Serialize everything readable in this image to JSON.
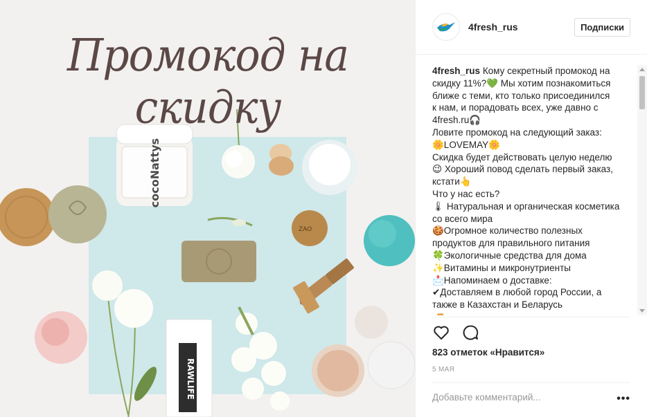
{
  "photo": {
    "title": "Промокод на скидку",
    "jar_brand": "cocoNattys",
    "bar_brand": "RAWLIFE",
    "compact_brand": "ZAO"
  },
  "post": {
    "username": "4fresh_rus",
    "follow_label": "Подписки",
    "caption_lines": [
      "Кому секретный промокод на",
      "скидку 11%?💚 Мы хотим познакомиться",
      "ближе с теми, кто только присоединился",
      "к нам, и порадовать всех, уже давно с",
      "4fresh.ru🎧",
      "Ловите промокод на следующий заказ:",
      "🌼LOVEMAY🌼",
      "Скидка будет действовать целую неделю",
      "😉 Хороший повод сделать первый заказ,",
      "кстати👆",
      "Что у нас есть?",
      "🌡 Натуральная и органическая косметика",
      "со всего мира",
      "🍪Огромное количество полезных",
      "продуктов для правильного питания",
      "🍀Экологичные средства для дома",
      "✨Витамины и микронутриенты",
      "📩Напоминаем о доставке:",
      "✔Доставляем в любой город России, а",
      "также в Казахстан и Беларусь",
      "🚚"
    ],
    "likes_count": "823",
    "likes_text": "отметок «Нравится»",
    "date": "5 МАЯ",
    "comment_placeholder": "Добавьте комментарий...",
    "more_label": "•••"
  },
  "icons": {
    "like": "heart-icon",
    "comment": "comment-icon",
    "avatar": "hummingbird-logo"
  },
  "colors": {
    "title": "#5b4846",
    "mint": "#cfe9ea",
    "accent_gray": "#999999"
  }
}
